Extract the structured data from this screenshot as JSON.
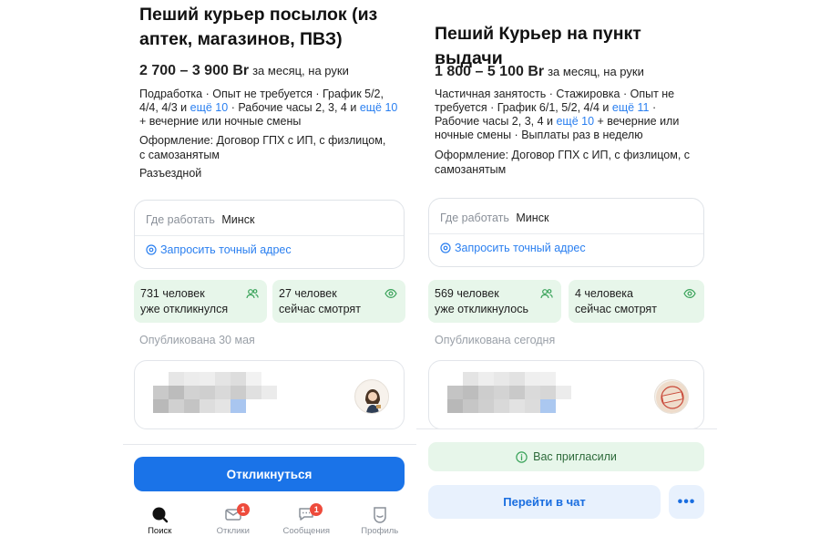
{
  "left": {
    "title": "Пеший курьер посылок (из аптек, магазинов, ПВЗ)",
    "salary": {
      "amount": "2 700 – 3 900 Br",
      "suffix": "за месяц, на руки"
    },
    "tags": {
      "part1": "Подработка · Опыт не требуется · График 5/2, 4/4, 4/3 и ",
      "link1": "ещё 10",
      "part2": " · Рабочие часы 2, 3, 4 и ",
      "link2": "ещё 10",
      "part3": " + вечерние или ночные смены"
    },
    "employment": "Оформление: Договор ГПХ с ИП, с физлицом, с самозанятым",
    "travel": "Разъездной",
    "address": {
      "label": "Где работать",
      "city": "Минск",
      "request": "Запросить точный адрес"
    },
    "stats": [
      {
        "line1": "731 человек",
        "line2": "уже откликнулся"
      },
      {
        "line1": "27 человек",
        "line2": "сейчас смотрят"
      }
    ],
    "published": "Опубликована 30 мая",
    "respond_button": "Откликнуться",
    "nav": [
      {
        "label": "Поиск",
        "badge": ""
      },
      {
        "label": "Отклики",
        "badge": "1"
      },
      {
        "label": "Сообщения",
        "badge": "1"
      },
      {
        "label": "Профиль",
        "badge": ""
      }
    ]
  },
  "right": {
    "title": "Пеший Курьер на пункт выдачи",
    "salary": {
      "amount": "1 800 – 5 100 Br",
      "suffix": "за месяц, на руки"
    },
    "tags": {
      "part1": "Частичная занятость · Стажировка · Опыт не требуется · График 6/1, 5/2, 4/4 и ",
      "link1": "ещё 11",
      "part2": " · Рабочие часы 2, 3, 4 и ",
      "link2": "ещё 10",
      "part3": " + вечерние или ночные смены · Выплаты раз в неделю"
    },
    "employment": "Оформление: Договор ГПХ с ИП, с физлицом, с самозанятым",
    "address": {
      "label": "Где работать",
      "city": "Минск",
      "request": "Запросить точный адрес"
    },
    "stats": [
      {
        "line1": "569 человек",
        "line2": "уже откликнулось"
      },
      {
        "line1": "4 человека",
        "line2": "сейчас смотрят"
      }
    ],
    "published": "Опубликована сегодня",
    "invited": "Вас пригласили",
    "chat_button": "Перейти в чат",
    "more_button": "•••"
  },
  "icons": {
    "location": "location-pin-icon",
    "people": "people-icon",
    "eye": "eye-icon",
    "info": "info-circle-icon",
    "search": "search-icon",
    "responses": "envelope-icon",
    "messages": "chat-bubble-icon",
    "profile": "profile-icon"
  },
  "colors": {
    "accent": "#1a73e8",
    "link": "#2a7ff0",
    "stat_bg": "#e7f6ea",
    "badge": "#ee4b3c",
    "muted": "#9aa0a8"
  }
}
